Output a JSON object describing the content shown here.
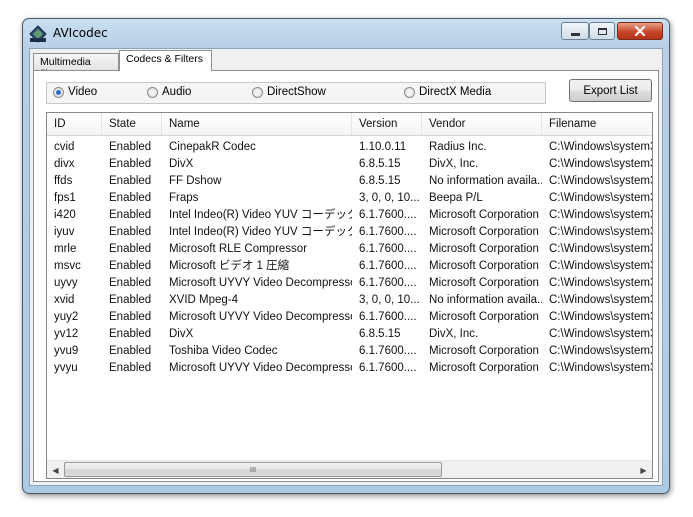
{
  "window": {
    "title": "AVIcodec"
  },
  "tabs": [
    {
      "label": "Multimedia files"
    },
    {
      "label": "Codecs & Filters"
    }
  ],
  "filters": [
    {
      "label": "Video",
      "selected": true
    },
    {
      "label": "Audio",
      "selected": false
    },
    {
      "label": "DirectShow",
      "selected": false
    },
    {
      "label": "DirectX Media",
      "selected": false
    }
  ],
  "export_button": {
    "label": "Export List"
  },
  "table": {
    "columns": [
      "ID",
      "State",
      "Name",
      "Version",
      "Vendor",
      "Filename"
    ],
    "rows": [
      [
        "cvid",
        "Enabled",
        "CinepakR Codec",
        "1.10.0.11",
        "Radius Inc.",
        "C:\\Windows\\system3"
      ],
      [
        "divx",
        "Enabled",
        "DivX",
        "6.8.5.15",
        "DivX, Inc.",
        "C:\\Windows\\system3"
      ],
      [
        "ffds",
        "Enabled",
        "FF Dshow",
        "6.8.5.15",
        "No information availa...",
        "C:\\Windows\\system3"
      ],
      [
        "fps1",
        "Enabled",
        "Fraps",
        "3, 0, 0, 10...",
        "Beepa P/L",
        "C:\\Windows\\system3"
      ],
      [
        "i420",
        "Enabled",
        "Intel Indeo(R) Video YUV コーデック",
        "6.1.7600....",
        "Microsoft Corporation",
        "C:\\Windows\\system3"
      ],
      [
        "iyuv",
        "Enabled",
        "Intel Indeo(R) Video YUV コーデック",
        "6.1.7600....",
        "Microsoft Corporation",
        "C:\\Windows\\system3"
      ],
      [
        "mrle",
        "Enabled",
        "Microsoft RLE Compressor",
        "6.1.7600....",
        "Microsoft Corporation",
        "C:\\Windows\\system3"
      ],
      [
        "msvc",
        "Enabled",
        "Microsoft ビデオ 1 圧縮",
        "6.1.7600....",
        "Microsoft Corporation",
        "C:\\Windows\\system3"
      ],
      [
        "uyvy",
        "Enabled",
        "Microsoft UYVY Video Decompressor",
        "6.1.7600....",
        "Microsoft Corporation",
        "C:\\Windows\\system3"
      ],
      [
        "xvid",
        "Enabled",
        "XVID Mpeg-4",
        "3, 0, 0, 10...",
        "No information availa...",
        "C:\\Windows\\system3"
      ],
      [
        "yuy2",
        "Enabled",
        "Microsoft UYVY Video Decompressor",
        "6.1.7600....",
        "Microsoft Corporation",
        "C:\\Windows\\system3"
      ],
      [
        "yv12",
        "Enabled",
        "DivX",
        "6.8.5.15",
        "DivX, Inc.",
        "C:\\Windows\\system3"
      ],
      [
        "yvu9",
        "Enabled",
        "Toshiba Video Codec",
        "6.1.7600....",
        "Microsoft Corporation",
        "C:\\Windows\\system3"
      ],
      [
        "yvyu",
        "Enabled",
        "Microsoft UYVY Video Decompressor",
        "6.1.7600....",
        "Microsoft Corporation",
        "C:\\Windows\\system3"
      ]
    ]
  },
  "scrollbar": {
    "thumb_grip": "III"
  },
  "icons": {
    "app": "avicodec-app-icon",
    "minimize": "minimize-icon",
    "maximize": "maximize-icon",
    "close": "close-icon",
    "scroll_left": "arrow-left-icon",
    "scroll_right": "arrow-right-icon"
  },
  "colors": {
    "accent": "#2c6ec5",
    "close_button": "#c7472a"
  }
}
